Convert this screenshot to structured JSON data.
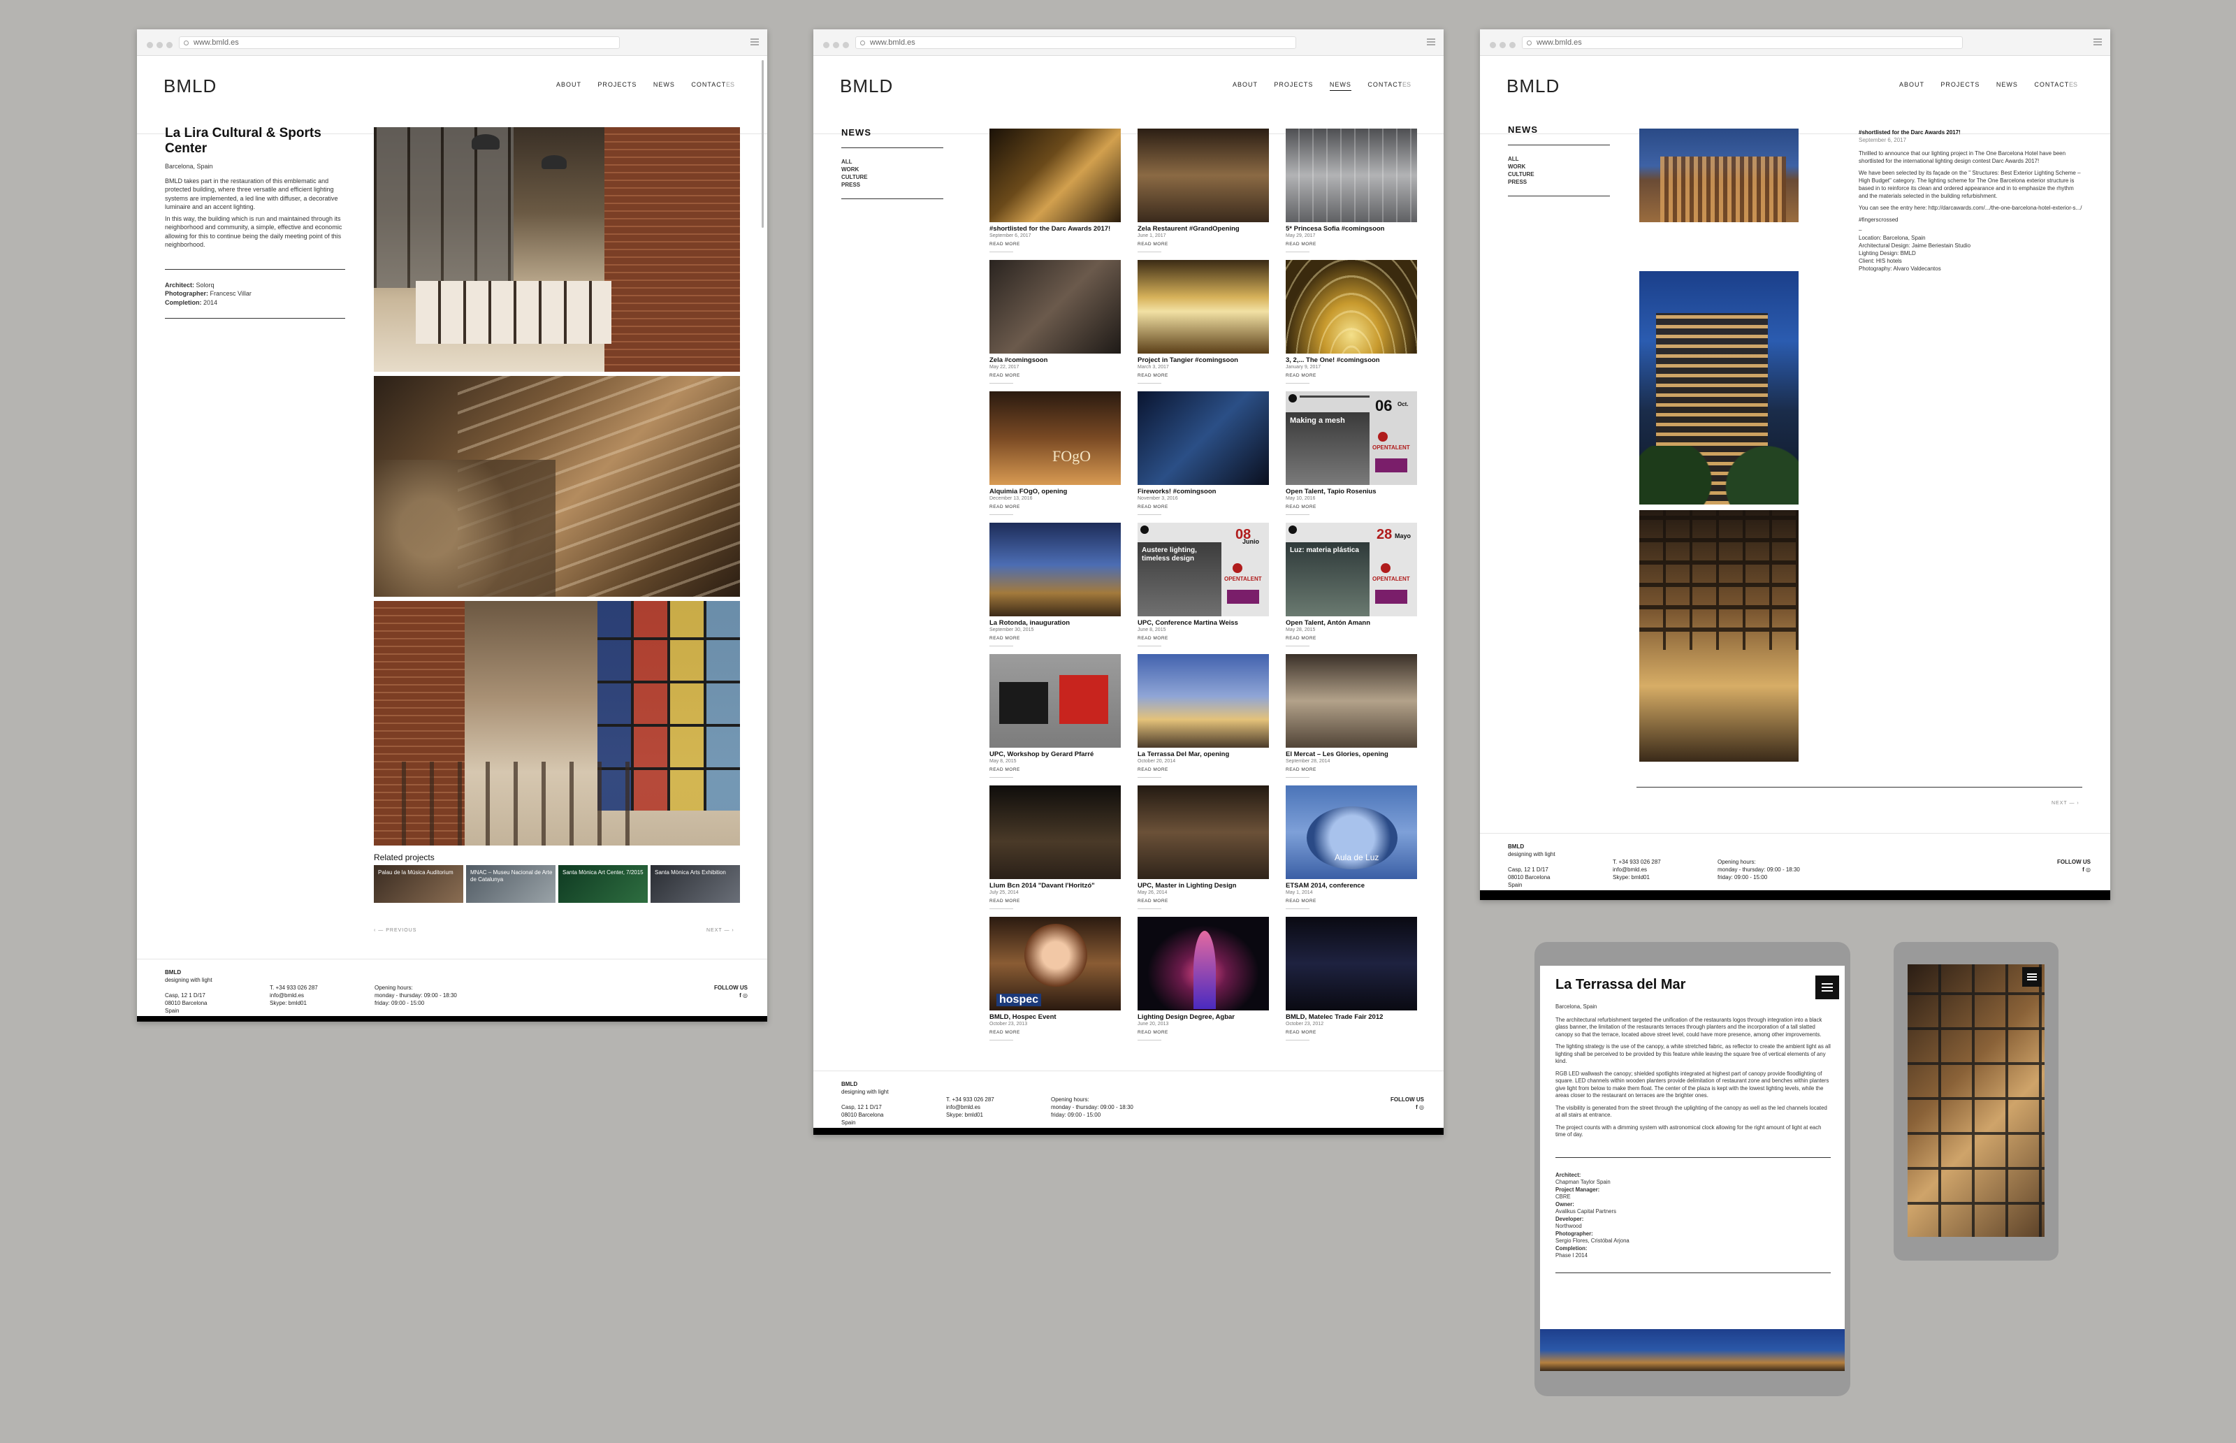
{
  "url": "www.bmld.es",
  "logo": "BMLD",
  "nav": {
    "about": "ABOUT",
    "projects": "PROJECTS",
    "news": "NEWS",
    "contact": "CONTACT",
    "lang": "ES"
  },
  "project": {
    "title": "La Lira Cultural & Sports Center",
    "location": "Barcelona, Spain",
    "p1": "BMLD takes part in the restauration of this emblematic and protected building, where three versatile and efficient lighting systems are implemented, a led line with diffuser, a decorative luminaire and an accent lighting.",
    "p2": "In this way, the building which is run and maintained through its neighborhood and community, a simple, effective and economic allowing for this to continue being the daily meeting point of this neighborhood.",
    "architect_label": "Architect:",
    "architect": "Solorq",
    "photographer_label": "Photographer:",
    "photographer": "Francesc Villar",
    "completion_label": "Completion:",
    "completion": "2014",
    "related_title": "Related projects",
    "related": [
      "Palau de la Música Auditorium",
      "MNAC – Museu Nacional de Arte de Catalunya",
      "Santa Mònica Art Center, 7/2015",
      "Santa Mònica Arts Exhibition"
    ],
    "prev": "PREVIOUS",
    "next": "NEXT"
  },
  "footer": {
    "name": "BMLD",
    "tagline": "designing with light",
    "addr1": "Casp, 12 1 D/17",
    "addr2": "08010 Barcelona",
    "addr3": "Spain",
    "tel": "T. +34 933 026 287",
    "email": "info@bmld.es",
    "skype": "Skype: bmld01",
    "hours_label": "Opening hours:",
    "hours1": "monday - thursday: 09:00 - 18:30",
    "hours2": "friday: 09:00 - 15:00",
    "follow": "FOLLOW US",
    "fb": "f",
    "ig": "◎"
  },
  "news": {
    "title": "NEWS",
    "filters": [
      "ALL",
      "WORK",
      "CULTURE",
      "PRESS"
    ],
    "read_more": "READ MORE",
    "items": [
      {
        "title": "#shortlisted for the Darc Awards 2017!",
        "date": "September 6, 2017"
      },
      {
        "title": "Zela Restaurent #GrandOpening",
        "date": "June 1, 2017"
      },
      {
        "title": "5* Princesa Sofia #comingsoon",
        "date": "May 29, 2017"
      },
      {
        "title": "Zela #comingsoon",
        "date": "May 22, 2017"
      },
      {
        "title": "Project in Tangier #comingsoon",
        "date": "March 3, 2017"
      },
      {
        "title": "3, 2,... The One! #comingsoon",
        "date": "January 9, 2017"
      },
      {
        "title": "Alquimia FOgO, opening",
        "date": "December 13, 2016"
      },
      {
        "title": "Fireworks! #comingsoon",
        "date": "November 3, 2016"
      },
      {
        "title": "Open Talent, Tapio Rosenius",
        "date": "May 10, 2016"
      },
      {
        "title": "La Rotonda, inauguration",
        "date": "September 30, 2015"
      },
      {
        "title": "UPC, Conference Martina Weiss",
        "date": "June 8, 2015"
      },
      {
        "title": "Open Talent, Antón Amann",
        "date": "May 28, 2015"
      },
      {
        "title": "UPC, Workshop by Gerard Pfarré",
        "date": "May 8, 2015"
      },
      {
        "title": "La Terrassa Del Mar, opening",
        "date": "October 20, 2014"
      },
      {
        "title": "El Mercat – Les Glories, opening",
        "date": "September 28, 2014"
      },
      {
        "title": "Llum Bcn 2014 \"Davant l'Horitzó\"",
        "date": "July 25, 2014"
      },
      {
        "title": "UPC, Master in Lighting Design",
        "date": "May 26, 2014"
      },
      {
        "title": "ETSAM 2014, conference",
        "date": "May 1, 2014"
      },
      {
        "title": "BMLD, Hospec Event",
        "date": "October 23, 2013"
      },
      {
        "title": "Lighting Design Degree, Agbar",
        "date": "June 20, 2013"
      },
      {
        "title": "BMLD, Matelec Trade Fair 2012",
        "date": "October 23, 2012"
      }
    ],
    "tile_texts": {
      "making_mesh": "Making a mesh",
      "open_talent": "OPENTALENT",
      "austere": "Austere lighting, timeless design",
      "jun_num": "08",
      "jun": "Junio",
      "luz": "Luz: materia plástica",
      "may_num": "28",
      "may": "Mayo",
      "oct_num": "06",
      "oct": "Oct.",
      "hospec": "hospec",
      "aula": "Aula de Luz",
      "fogo": "FOgO"
    }
  },
  "article": {
    "title": "#shortlisted for the Darc Awards 2017!",
    "date": "September 6, 2017",
    "p1": "Thrilled to announce that our lighting project in The One Barcelona Hotel have been shortlisted for the international lighting design contest Darc Awards 2017!",
    "p2": "We have been selected by its façade on the \" Structures: Best Exterior Lighting Scheme – High Budget\" category. The lighting scheme for The One Barcelona exterior structure is based in to reinforce its clean and ordered appearance and in to emphasize the rhythm and the materials selected in the building refurbishment.",
    "p3": "You can see the entry here: http://darcawards.com/.../the-one-barcelona-hotel-exterior-s.../",
    "hashtag": "#fingerscrossed",
    "dash": "–",
    "m1": "Location: Barcelona, Spain",
    "m2": "Architectural Design: Jaime Beriestain Studio",
    "m3": "Lighting Design: BMLD",
    "m4": "Client: HIS hotels",
    "m5": "Photography: Alvaro Valdecantos",
    "next": "NEXT"
  },
  "tablet": {
    "title": "La Terrassa del Mar",
    "location": "Barcelona, Spain",
    "p1": "The architectural refurbishment targeted the unification of the restaurants logos through integration into a black glass banner, the limitation of the restaurants terraces through planters and the incorporation of a tall slatted canopy so that the terrace, located above street level, could have more presence, among other improvements.",
    "p2": "The lighting strategy is the use of the canopy, a white stretched fabric, as reflector to create the ambient light as all lighting shall be perceived to be provided by this feature while leaving the square free of vertical elements of any kind.",
    "p3": "RGB LED wallwash the canopy; shielded spotlights integrated at highest part of canopy provide floodlighting of square. LED channels within wooden planters provide delimitation of restaurant zone and benches within planters give light from below to make them float. The center of the plaza is kept with the lowest lighting levels, while the areas closer to the restaurant on terraces are the brighter ones.",
    "p4": "The visibility is generated from the street through the uplighting of the canopy as well as the led channels located at all stairs at entrance.",
    "p5": "The project counts with a dimming system with astronomical clock allowing for the right amount of light at each time of day.",
    "credits": [
      {
        "label": "Architect:",
        "value": "Chapman Taylor Spain"
      },
      {
        "label": "Project Manager:",
        "value": "CBRE"
      },
      {
        "label": "Owner:",
        "value": "Avalikus Capital Partners"
      },
      {
        "label": "Developer:",
        "value": "Northwood"
      },
      {
        "label": "Photographer:",
        "value": "Sergio Flores, Cristóbal Arjona"
      },
      {
        "label": "Completion:",
        "value": "Phase I 2014"
      }
    ]
  },
  "colors": {
    "background": "#b5b4b1",
    "device": "#9a9a9a",
    "footer_bar": "#000000"
  }
}
